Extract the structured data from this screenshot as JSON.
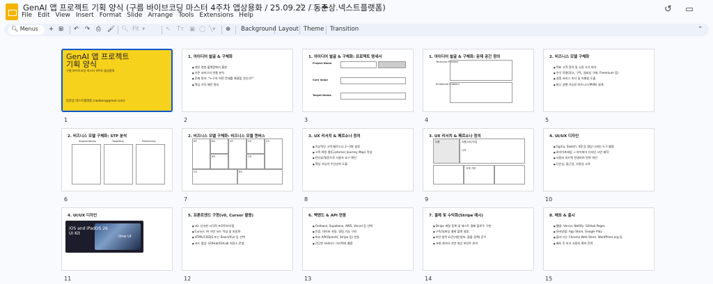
{
  "app": {
    "title": "GenAI 앱 프로젝트 기획 양식 (구름 바이브코딩 마스터 4주차 앱상용화 / 25.09.22 / 동준상.넥스트플랫폼)",
    "menu": [
      "File",
      "Edit",
      "View",
      "Insert",
      "Format",
      "Slide",
      "Arrange",
      "Tools",
      "Extensions",
      "Help"
    ]
  },
  "toolbar": {
    "menus_label": "Menus",
    "fit_label": "Fit",
    "background_label": "Background",
    "layout_label": "Layout",
    "theme_label": "Theme",
    "transition_label": "Transition"
  },
  "slides": [
    {
      "num": "1",
      "cover_title": "GenAI 앱 프로젝트\n기획 양식",
      "cover_sub": "구름 바이브코딩 마스터 4주차 앱상용화",
      "cover_author": "동준상.넥스트플랫폼 (naebon@gmail.com)"
    },
    {
      "num": "2",
      "title": "1. 아이디어 발굴 & 구체화",
      "bullets": [
        "개인 경험 불편함에서 출발",
        "기존 서비스의 빈틈 분석",
        "문제 정의: \"누구의 어떤 문제를 해결할 것인가?\"",
        "핵심 가치 제안 정리"
      ]
    },
    {
      "num": "3",
      "title": "1. 아이디어 발굴 & 구체화: 프로젝트 명세서",
      "labels": [
        "Project Name",
        "Core Value",
        "Target Needs"
      ]
    },
    {
      "num": "4",
      "title": "1. 아이디어 발굴 & 구체화: 문제 공간 정의",
      "labels": [
        "Technical Problem",
        "Emotional Problem"
      ]
    },
    {
      "num": "5",
      "title": "2. 비즈니스 모델 구체화",
      "bullets": [
        "목표 고객 정의 및 시장 크기 파악",
        "수익 모델(광고, 구독, 일회성 구매, Freemium 등)",
        "경쟁 서비스 조사 및 차별점 도출",
        "최소 실행 가능한 비즈니스(MVB) 설계"
      ]
    },
    {
      "num": "6",
      "title": "2. 비즈니스 모델 구체화: STP 분석",
      "labels": [
        "Segmentation",
        "Targeting",
        "Positioning"
      ]
    },
    {
      "num": "7",
      "title": "2. 비즈니스 모델 구체화: 비즈니스 모델 캔버스",
      "labels": [
        "KP",
        "KA",
        "VP",
        "CR",
        "CS",
        "KR",
        "CH",
        "CS",
        "RS"
      ]
    },
    {
      "num": "8",
      "title": "3. UX 리서치 & 페르소나 정의",
      "bullets": [
        "이상적인 고객 페르소나 2~3명 설정",
        "고객 여정 맵(Customer Journey Map) 작성",
        "인터뷰/설문으로 사용자 요구 확인",
        "핵심 기능의 우선순위 도출"
      ]
    },
    {
      "num": "9",
      "title": "3. UX 리서치 & 페르소나 정의",
      "labels": [
        "이름",
        "이름/나이/직업",
        "니즈",
        "고객 가치"
      ]
    },
    {
      "num": "10",
      "title": "4. UI/UX 디자인",
      "bullets": [
        "Figma, Sketch, XD 등 협업 디자인 도구 활용",
        "와이어프레임 → 하이파이 디자인 시안 제작",
        "사용자 피드백 반영하여 반복 개선",
        "단순성, 접근성, 사용성 고려"
      ]
    },
    {
      "num": "11",
      "title": "4. UI/UX 디자인",
      "hero": "iOS and iPadOS 26\nUI Kit",
      "hero2": "One UI"
    },
    {
      "num": "12",
      "title": "5. 프론트엔드 구현(v0, Cursor 활용)",
      "bullets": [
        "v0: 신속한 시각적 프로토타이핑",
        "Cursor: AI 기반 코드 작성 및 자동화",
        "HTML/CSS/JS 또는 React/Vue 등 선택",
        "코드 협업: GitHub/GitLab 저장소 운영"
      ]
    },
    {
      "num": "13",
      "title": "6. 백엔드 & API 연동",
      "bullets": [
        "Firebase, Supabase, AWS, Vercel 등 선택",
        "인증, 데이터 저장, 알림 기능 구현",
        "외부 API(OpenAI, Stripe 등) 연동",
        "간단한 서버리스 아키텍처 활용"
      ]
    },
    {
      "num": "14",
      "title": "7. 결제 및 수익화(Stripe 예시)",
      "bullets": [
        "Stripe 계정 등록 및 테스트 결제 플로우 구현",
        "구독/일회성 결제 플랜 설정",
        "보안 법적 요건(개인정보, 환불 정책) 준수",
        "거래 데이터 기반 개선 포인트 분석"
      ]
    },
    {
      "num": "15",
      "title": "8. 배포 & 출시",
      "bullets": [
        "웹앱: Vercel, Netlify, GitHub Pages",
        "모바일앱: App Store, Google Play",
        "플러그인: Chrome Web Store, WordPress.org 등",
        "배포 후 초기 사용자 확보 전략"
      ]
    }
  ]
}
